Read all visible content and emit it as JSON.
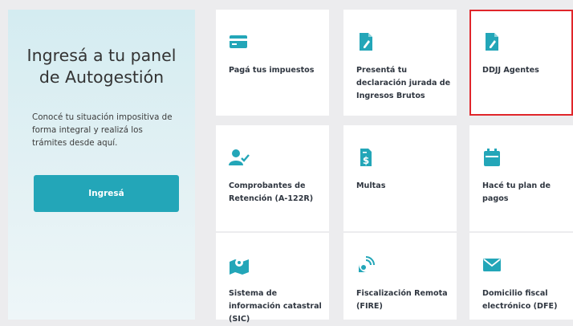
{
  "left_panel": {
    "title_line1": "Ingresá a tu panel",
    "title_line2": "de Autogestión",
    "description": "Conocé tu situación impositiva de forma integral y realizá los trámites desde aquí.",
    "button_label": "Ingresá"
  },
  "cards": [
    {
      "label": "Pagá tus impuestos",
      "icon": "credit-card-icon"
    },
    {
      "label": "Presentá tu declaración jurada de Ingresos Brutos",
      "icon": "document-edit-icon"
    },
    {
      "label": "DDJJ Agentes",
      "icon": "document-edit-icon",
      "selected": true
    },
    {
      "label": "Comprobantes de Retención (A-122R)",
      "icon": "user-check-icon"
    },
    {
      "label": "Multas",
      "icon": "dollar-document-icon"
    },
    {
      "label": "Hacé tu plan de pagos",
      "icon": "calendar-icon"
    },
    {
      "label": "Sistema de información catastral (SIC)",
      "icon": "map-pin-icon"
    },
    {
      "label": "Fiscalización Remota (FIRE)",
      "icon": "satellite-icon"
    },
    {
      "label": "Domicilio fiscal electrónico (DFE)",
      "icon": "envelope-icon"
    }
  ],
  "colors": {
    "accent": "#23a6b8",
    "selected_border": "#e0262b",
    "panel_bg": "#d4ecf1"
  }
}
